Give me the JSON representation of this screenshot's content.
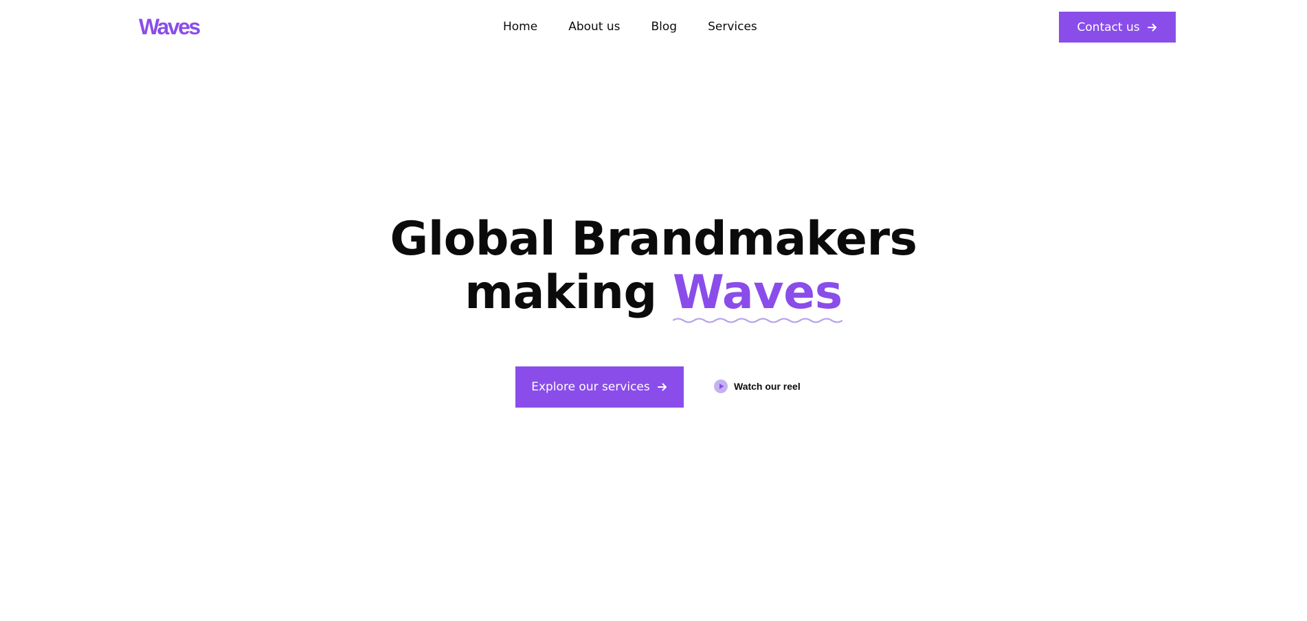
{
  "brand": {
    "logo_text": "Waves",
    "accent_color": "#8a4dea"
  },
  "nav": {
    "items": [
      {
        "label": "Home"
      },
      {
        "label": "About us"
      },
      {
        "label": "Blog"
      },
      {
        "label": "Services"
      }
    ]
  },
  "header": {
    "contact_label": "Contact us",
    "contact_icon": "arrow-right-icon"
  },
  "hero": {
    "title_line1": "Global Brandmakers",
    "title_line2_prefix": "making",
    "title_highlight": "Waves",
    "primary_cta_label": "Explore our services",
    "primary_cta_icon": "arrow-right-icon",
    "secondary_cta_label": "Watch our reel",
    "secondary_cta_icon": "play-icon"
  }
}
